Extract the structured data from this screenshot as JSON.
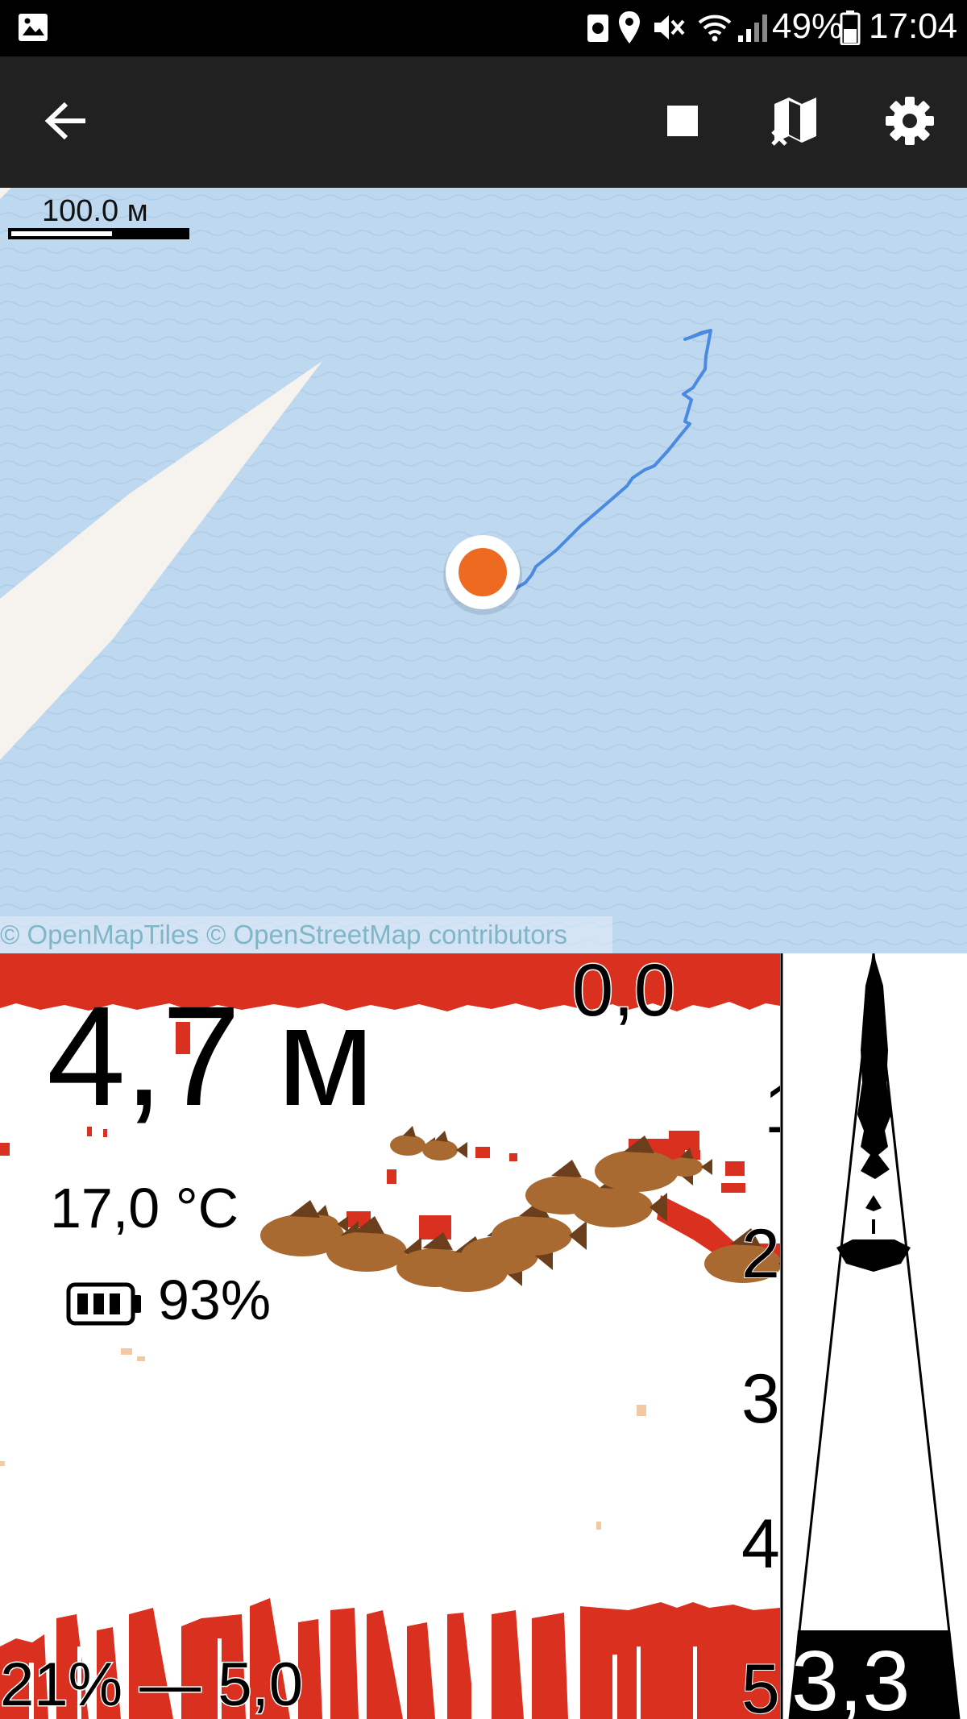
{
  "status_bar": {
    "battery": "49%",
    "time": "17:04",
    "icons": [
      "image-icon",
      "app-notification-icon",
      "location-icon",
      "mute-icon",
      "wifi-icon",
      "signal-icon",
      "battery-icon"
    ]
  },
  "toolbar": {
    "icons": [
      "back-arrow-icon",
      "stop-icon",
      "map-off-icon",
      "gear-icon"
    ]
  },
  "map": {
    "scale_label": "100.0 м",
    "attribution": "© OpenMapTiles © OpenStreetMap contributors",
    "colors": {
      "water": "#bed8f0",
      "land": "#f6f3ee",
      "track": "#4a8ae0",
      "position": "#ee6a21"
    }
  },
  "sonar": {
    "depth": "4,7 м",
    "temperature": "17,0 °C",
    "battery": "93%",
    "top_depth": "0,0",
    "scale_ticks": [
      "1",
      "2",
      "3",
      "4",
      "5"
    ],
    "range_info": "21% — 5,0",
    "colors": {
      "echo": "#d93020",
      "fish": "#a86a30"
    }
  },
  "flasher": {
    "value": "3,3"
  }
}
